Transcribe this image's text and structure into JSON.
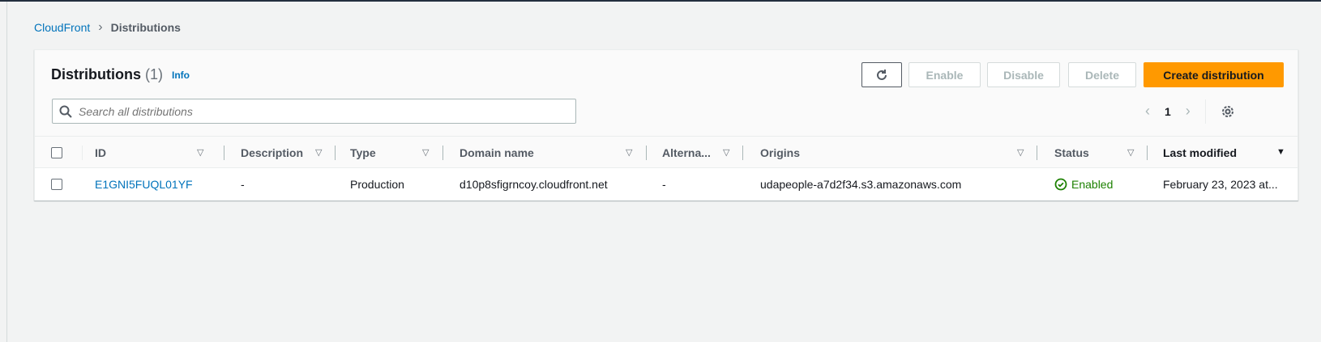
{
  "breadcrumb": {
    "root": "CloudFront",
    "current": "Distributions"
  },
  "header": {
    "title": "Distributions",
    "count": "(1)",
    "info": "Info"
  },
  "toolbar": {
    "enable": "Enable",
    "disable": "Disable",
    "delete": "Delete",
    "create": "Create distribution"
  },
  "search": {
    "placeholder": "Search all distributions",
    "value": ""
  },
  "pagination": {
    "page": "1"
  },
  "colors": {
    "primary": "#ff9900",
    "link": "#0073bb",
    "success": "#1d8102"
  },
  "table": {
    "columns": [
      "ID",
      "Description",
      "Type",
      "Domain name",
      "Alterna...",
      "Origins",
      "Status",
      "Last modified"
    ],
    "sorted_column": "Last modified",
    "rows": [
      {
        "id": "E1GNI5FUQL01YF",
        "description": "-",
        "type": "Production",
        "domain": "d10p8sfigrncoy.cloudfront.net",
        "alternate": "-",
        "origins": "udapeople-a7d2f34.s3.amazonaws.com",
        "status": "Enabled",
        "last_modified": "February 23, 2023 at..."
      }
    ]
  }
}
